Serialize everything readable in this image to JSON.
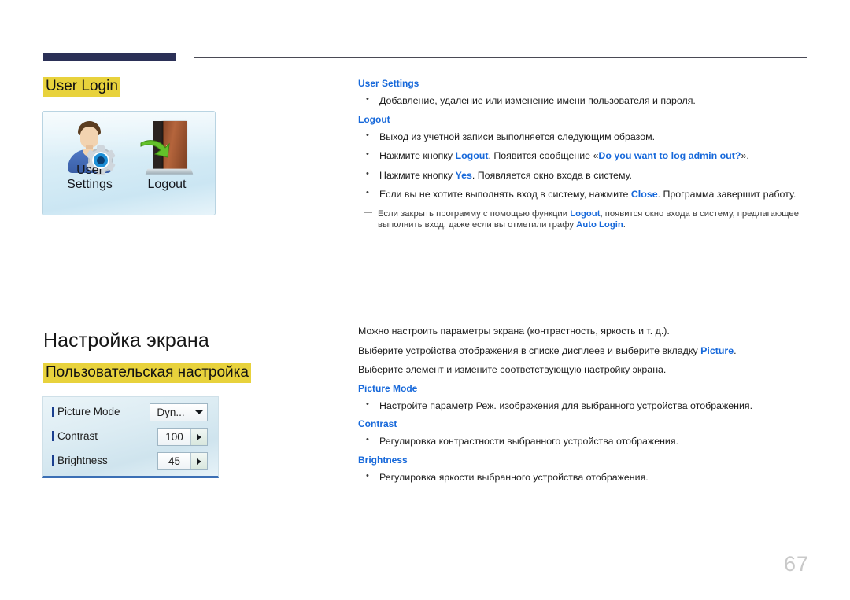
{
  "page": {
    "number": "67",
    "accent_dark": "#2b3057",
    "highlight_yellow": "#e8d23c",
    "link_blue": "#1668da"
  },
  "section_user_login": {
    "heading": "User Login",
    "figure": {
      "name": "user-login-screen",
      "items": [
        {
          "icon": "user-settings-icon",
          "caption": "User Settings"
        },
        {
          "icon": "logout-door-icon",
          "caption": "Logout"
        }
      ]
    },
    "text": [
      {
        "type": "blue-head",
        "text": "User Settings"
      },
      {
        "type": "bullet",
        "html": "Добавление, удаление или изменение имени пользователя и пароля."
      },
      {
        "type": "blue-head",
        "text": "Logout"
      },
      {
        "type": "bullet",
        "html": "Выход из учетной записи выполняется следующим образом."
      },
      {
        "type": "bullet",
        "html": "Нажмите кнопку <b class=\"blue\">Logout</b>. Появится сообщение «<b class=\"blue\">Do you want to log admin out?</b>»."
      },
      {
        "type": "bullet",
        "html": "Нажмите кнопку <b class=\"blue\">Yes</b>. Появляется окно входа в систему."
      },
      {
        "type": "bullet",
        "html": "Если вы не хотите выполнять вход в систему, нажмите <b class=\"blue\">Close</b>. Программа завершит работу."
      },
      {
        "type": "note",
        "html": "Если закрыть программу с помощью функции <b class=\"blue\">Logout</b>, появится окно входа в систему, предлагающее выполнить вход, даже если вы отметили графу <b class=\"blue\">Auto Login</b>."
      }
    ]
  },
  "section_screen_setup": {
    "heading": "Настройка экрана",
    "subheading": "Пользовательская настройка",
    "figure": {
      "name": "picture-settings-panel",
      "rows": [
        {
          "label": "Picture Mode",
          "value": "Dyn...",
          "control": "combobox"
        },
        {
          "label": "Contrast",
          "value": "100",
          "control": "spinner"
        },
        {
          "label": "Brightness",
          "value": "45",
          "control": "spinner"
        }
      ]
    },
    "text": [
      {
        "type": "plain",
        "html": "Можно настроить параметры экрана (контрастность, яркость и т. д.)."
      },
      {
        "type": "plain",
        "html": "Выберите устройства отображения в списке дисплеев и выберите вкладку <b class=\"blue\">Picture</b>."
      },
      {
        "type": "plain",
        "html": "Выберите элемент и измените соответствующую настройку экрана."
      },
      {
        "type": "blue-head",
        "text": "Picture Mode"
      },
      {
        "type": "bullet",
        "html": "Настройте параметр Реж. изображения для выбранного устройства отображения."
      },
      {
        "type": "blue-head",
        "text": "Contrast"
      },
      {
        "type": "bullet",
        "html": "Регулировка контрастности выбранного устройства отображения."
      },
      {
        "type": "blue-head",
        "text": "Brightness"
      },
      {
        "type": "bullet",
        "html": "Регулировка яркости выбранного устройства отображения."
      }
    ]
  }
}
